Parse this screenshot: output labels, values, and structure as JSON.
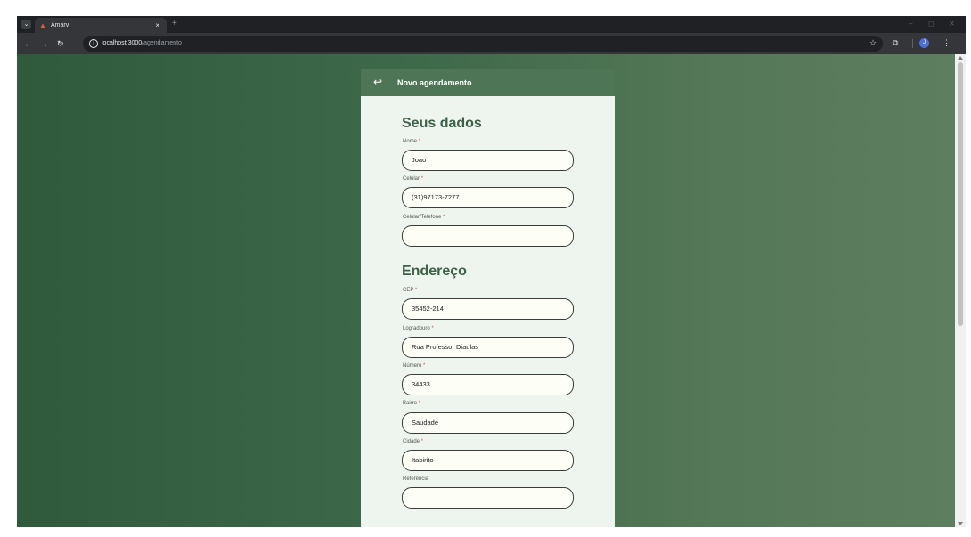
{
  "browser": {
    "tab_title": "Amarv",
    "close_glyph": "×",
    "new_tab_glyph": "+",
    "url_host": "localhost:3000",
    "url_path": "/agendamento",
    "avatar_letter": "J",
    "icons": [
      "tab-search-icon",
      "favicon-icon",
      "back-icon",
      "forward-icon",
      "reload-icon",
      "info-icon",
      "star-icon",
      "extensions-icon",
      "menu-icon"
    ]
  },
  "header": {
    "title": "Novo agendamento",
    "back_icon": "return-arrow-icon"
  },
  "sections": {
    "dados_title": "Seus dados",
    "endereco_title": "Endereço"
  },
  "fields": {
    "nome": {
      "label": "Nome",
      "value": "Joao"
    },
    "celular": {
      "label": "Celular",
      "value": "(31)97173-7277"
    },
    "celular_telefone": {
      "label": "Celular/Telefone",
      "value": ""
    },
    "cep": {
      "label": "CEP",
      "value": "35452-214"
    },
    "logradouro": {
      "label": "Logradouro",
      "value": "Rua Professor Diaulas"
    },
    "numero": {
      "label": "Número",
      "value": "34433"
    },
    "bairro": {
      "label": "Bairro",
      "value": "Saudade"
    },
    "cidade": {
      "label": "Cidade",
      "value": "Itabirito"
    },
    "referencia": {
      "label": "Referência",
      "value": ""
    }
  },
  "required_mark": "*",
  "colors": {
    "header_bg": "#4e7656",
    "card_bg": "#eef5ee",
    "section_title": "#3d6146",
    "required": "#e04848",
    "page_bg": "#3f6a4b"
  }
}
